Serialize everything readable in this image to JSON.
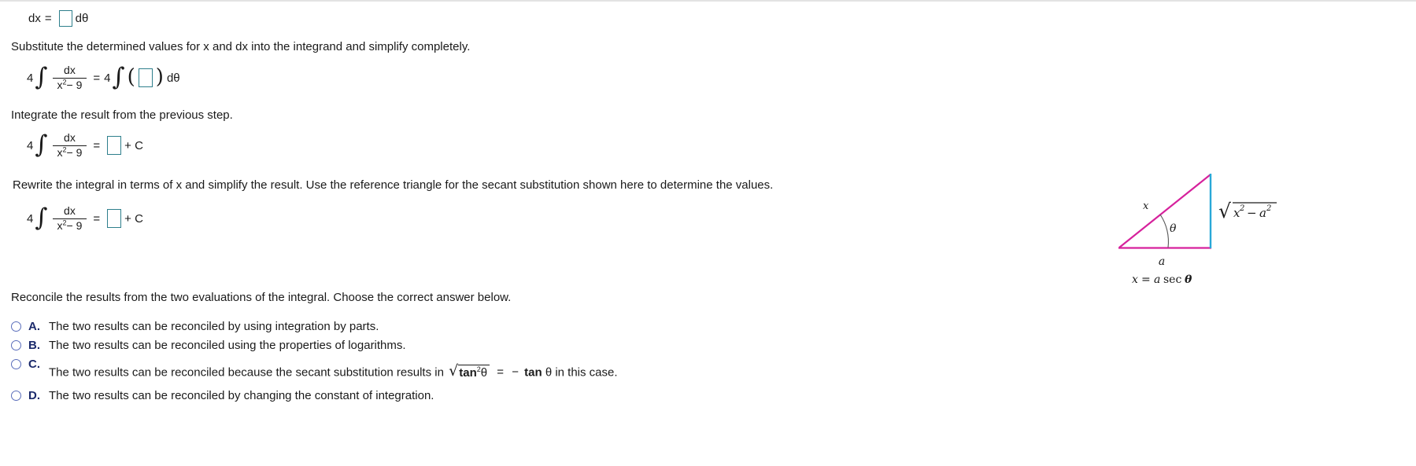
{
  "accent": {
    "input_border": "#2e7f8c",
    "radio": "#5b6ebb",
    "letter": "#1b2a6b",
    "triangle_pink": "#d6219c",
    "triangle_blue": "#29a8d8"
  },
  "steps": {
    "dx_line": {
      "lhs": "dx",
      "equals": "=",
      "trailing": "dθ"
    },
    "substitute_prompt": "Substitute the determined values for x and dx into the integrand and simplify completely.",
    "substitute_equation": {
      "coefficient": "4",
      "integral": "∫",
      "numerator": "dx",
      "denominator_base": "x",
      "denominator_exponent": "2",
      "denominator_tail": "− 9",
      "equals": "=",
      "rhs_coefficient": "4",
      "rhs_integral": "∫",
      "rhs_differential": "dθ"
    },
    "integrate_prompt": "Integrate the result from the previous step.",
    "integrate_equation": {
      "coefficient": "4",
      "integral": "∫",
      "numerator": "dx",
      "denominator_base": "x",
      "denominator_exponent": "2",
      "denominator_tail": "− 9",
      "equals": "=",
      "plus_c": "+ C"
    },
    "rewrite_prompt": "Rewrite the integral in terms of x and simplify the result. Use the reference triangle for the secant substitution shown here to determine the values.",
    "rewrite_equation": {
      "coefficient": "4",
      "integral": "∫",
      "numerator": "dx",
      "denominator_base": "x",
      "denominator_exponent": "2",
      "denominator_tail": "− 9",
      "equals": "=",
      "plus_c": "+ C"
    }
  },
  "figure": {
    "hypotenuse_label": "x",
    "angle_label": "θ",
    "opposite_label_radical": "√",
    "opposite_label_x": "x",
    "opposite_label_x_exp": "2",
    "opposite_label_minus": "−",
    "opposite_label_a": "a",
    "opposite_label_a_exp": "2",
    "adjacent_label": "a",
    "caption": "x = a sec θ",
    "caption_x": "x",
    "caption_eq": "=",
    "caption_a": "a",
    "caption_sec": "sec",
    "caption_theta": "θ"
  },
  "question": {
    "prompt": "Reconcile the results from the two evaluations of the integral. Choose the correct answer below.",
    "options": [
      {
        "letter": "A.",
        "text": "The two results can be reconciled by using integration by parts."
      },
      {
        "letter": "B.",
        "text": "The two results can be reconciled using the properties of logarithms."
      },
      {
        "letter": "C.",
        "text_before": "The two results can be reconciled because the secant substitution results in",
        "radical_tan": "tan",
        "radical_exp": "2",
        "radical_theta": "θ",
        "equals": "=",
        "minus": "−",
        "tan": "tan",
        "theta": "θ",
        "text_after": "in this case.",
        "text_full": "The two results can be reconciled because the secant substitution results in √tan²θ = − tan θ in this case."
      },
      {
        "letter": "D.",
        "text": "The two results can be reconciled by changing the constant of integration."
      }
    ]
  }
}
